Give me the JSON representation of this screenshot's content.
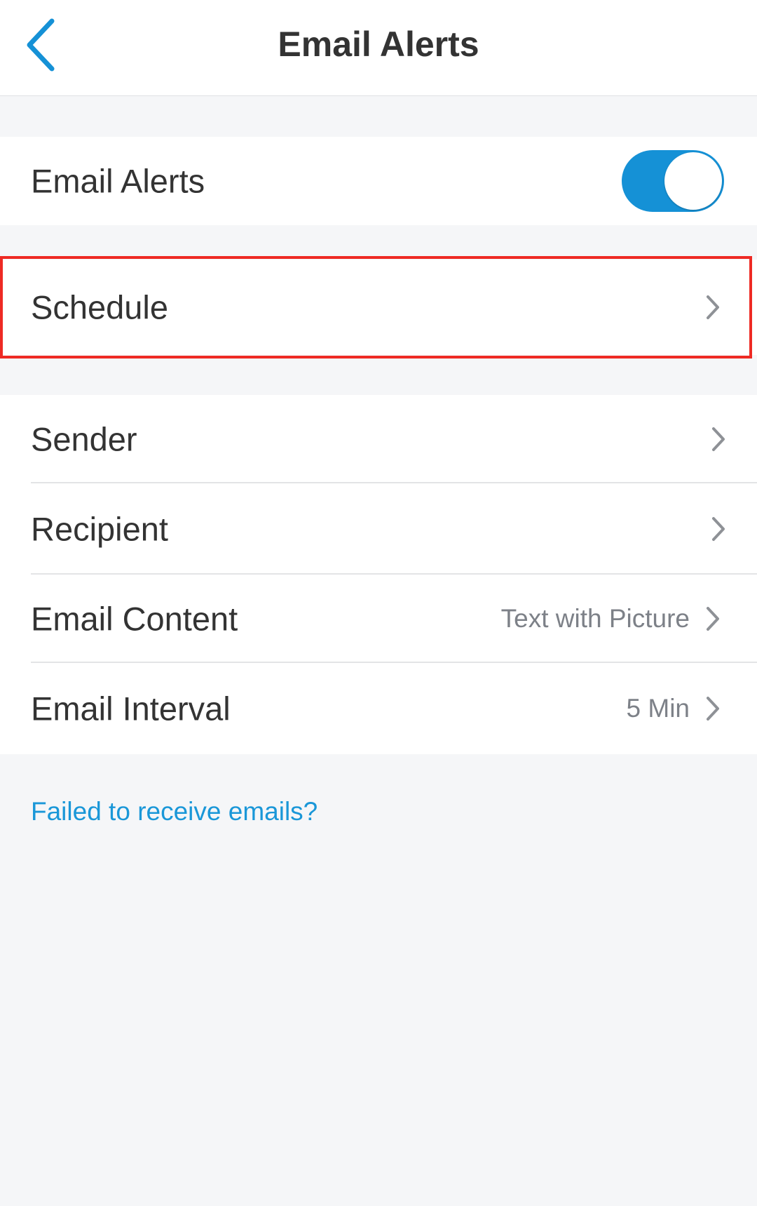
{
  "header": {
    "title": "Email Alerts",
    "back_icon": "chevron-left-icon"
  },
  "colors": {
    "accent": "#1591d6",
    "link": "#1a97d8",
    "highlight_border": "#ee2a24",
    "background": "#f5f6f8"
  },
  "email_alerts": {
    "label": "Email Alerts",
    "toggle_on": true
  },
  "schedule": {
    "label": "Schedule"
  },
  "settings": {
    "sender": {
      "label": "Sender"
    },
    "recipient": {
      "label": "Recipient"
    },
    "email_content": {
      "label": "Email Content",
      "value": "Text with Picture"
    },
    "email_interval": {
      "label": "Email Interval",
      "value": "5 Min"
    }
  },
  "help": {
    "link_text": "Failed to receive emails?"
  }
}
